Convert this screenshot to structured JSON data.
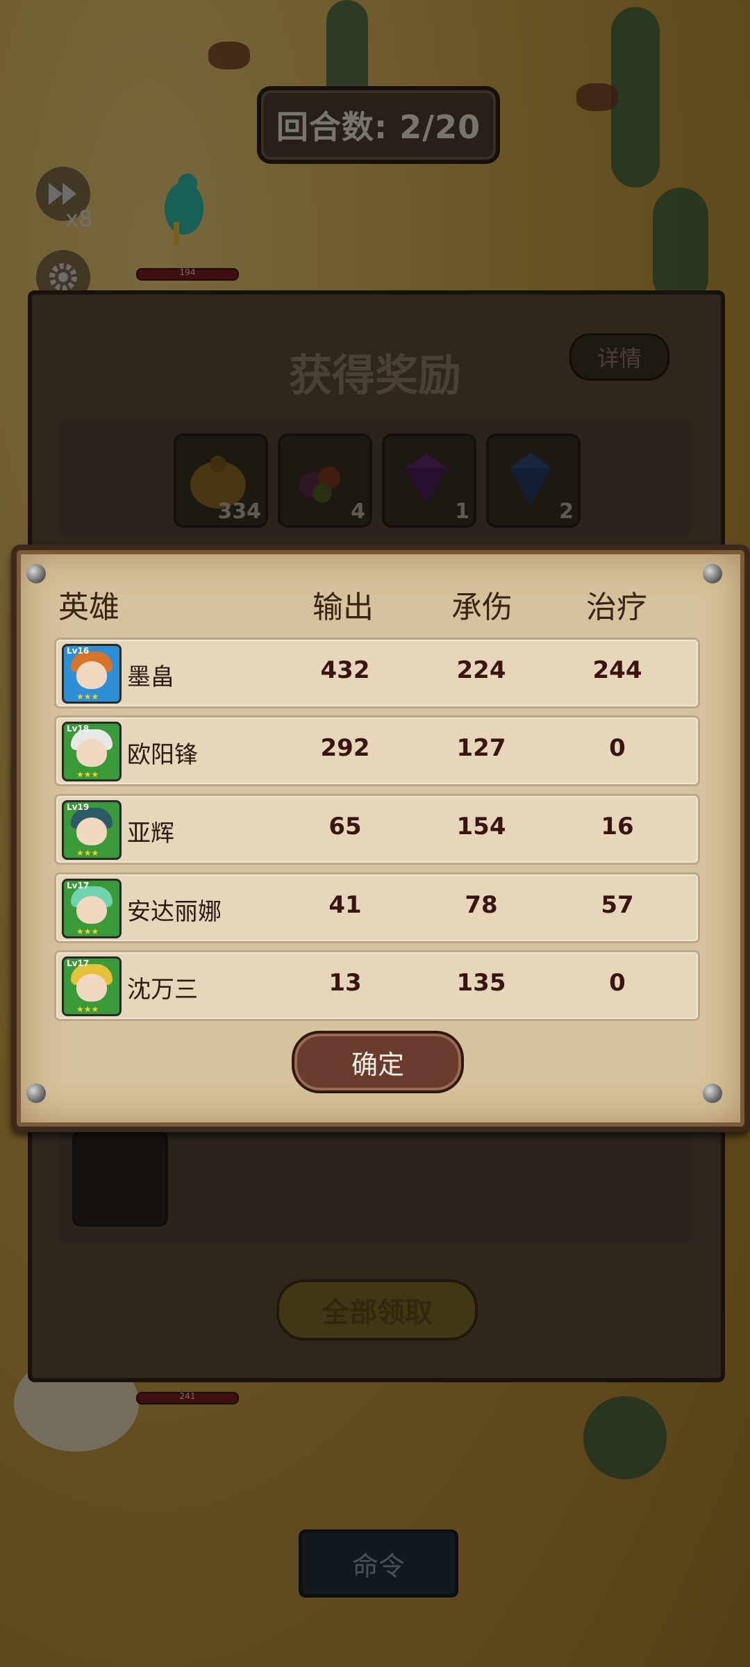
{
  "hud": {
    "round_label": "回合数: 2/20",
    "speed_label": "x8",
    "enemy_hp_top": "194",
    "enemy_hp_bottom": "241"
  },
  "reward_panel": {
    "title": "获得奖励",
    "detail_button": "详情",
    "items": [
      {
        "icon": "gold-bag-icon",
        "count": "334"
      },
      {
        "icon": "fruit-basket-icon",
        "count": "4"
      },
      {
        "icon": "purple-gem-icon",
        "count": "1"
      },
      {
        "icon": "blue-gem-icon",
        "count": "2"
      }
    ],
    "claim_all_button": "全部领取"
  },
  "stats_dialog": {
    "headers": {
      "hero": "英雄",
      "damage": "输出",
      "taken": "承伤",
      "heal": "治疗"
    },
    "rows": [
      {
        "name": "墨畠",
        "level": "Lv16",
        "damage": "432",
        "taken": "224",
        "heal": "244",
        "frame_color": "#2f8fd6",
        "hair_color": "#d8742a"
      },
      {
        "name": "欧阳锋",
        "level": "Lv18",
        "damage": "292",
        "taken": "127",
        "heal": "0",
        "frame_color": "#3a9a3a",
        "hair_color": "#e8e8e8"
      },
      {
        "name": "亚辉",
        "level": "Lv19",
        "damage": "65",
        "taken": "154",
        "heal": "16",
        "frame_color": "#3a9a3a",
        "hair_color": "#2c5a66"
      },
      {
        "name": "安达丽娜",
        "level": "Lv17",
        "damage": "41",
        "taken": "78",
        "heal": "57",
        "frame_color": "#3a9a3a",
        "hair_color": "#6fd3b0"
      },
      {
        "name": "沈万三",
        "level": "Lv17",
        "damage": "13",
        "taken": "135",
        "heal": "0",
        "frame_color": "#3a9a3a",
        "hair_color": "#e6c23a"
      }
    ],
    "confirm_button": "确定"
  },
  "command_button": "命令",
  "colors": {
    "panel": "#d6c29c",
    "row": "#e6d7bb",
    "text_dark": "#3b1412"
  }
}
